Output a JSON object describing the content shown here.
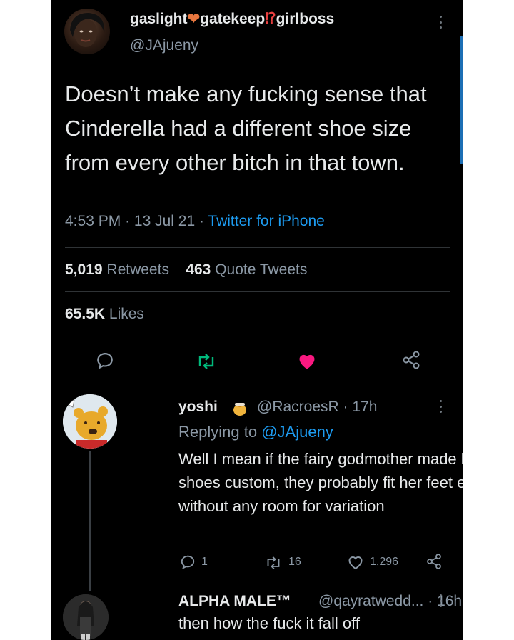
{
  "main_tweet": {
    "display_name": "gaslight",
    "display_name_mid": "gatekeep",
    "display_name_end": "girlboss",
    "handle": "@JAjueny",
    "text": "Doesn’t make any fucking sense that Cinderella had a different shoe size from every other bitch in that town.",
    "time": "4:53 PM",
    "date": "13 Jul 21",
    "source": "Twitter for iPhone",
    "retweets_count": "5,019",
    "retweets_label": "Retweets",
    "quotes_count": "463",
    "quotes_label": "Quote Tweets",
    "likes_count": "65.5K",
    "likes_label": "Likes"
  },
  "reply_1": {
    "display_name": "yoshi",
    "handle": "@RacroesR",
    "time": "17h",
    "replying_prefix": "Replying to",
    "replying_to": "@JAjueny",
    "text": "Well I mean if the fairy godmother made her shoes custom, they probably fit her feet exactly without any room for variation",
    "reply_count": "1",
    "retweet_count": "16",
    "like_count": "1,296"
  },
  "reply_2": {
    "display_name": "ALPHA MALE™",
    "handle": "@qayratwedd...",
    "time": "16h",
    "text": "then how the fuck it fall off"
  },
  "colors": {
    "background": "#000000",
    "link": "#1d9bf0",
    "muted": "#8b98a5",
    "like_active": "#f91880",
    "retweet": "#00ba7c"
  }
}
